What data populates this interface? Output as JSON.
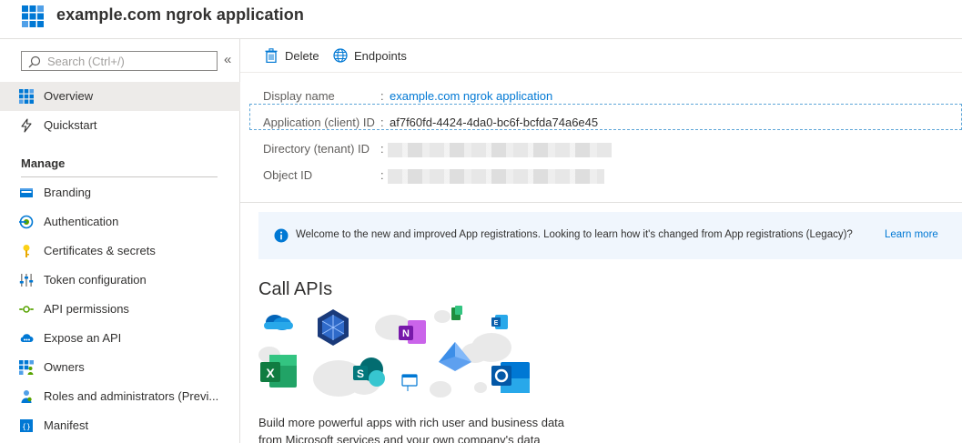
{
  "app": {
    "title": "example.com ngrok application"
  },
  "sidebar": {
    "search_placeholder": "Search (Ctrl+/)",
    "collapse_glyph": "«",
    "top_items": [
      {
        "label": "Overview",
        "icon": "grid-icon",
        "active": true
      },
      {
        "label": "Quickstart",
        "icon": "lightning-icon",
        "active": false
      }
    ],
    "manage_header": "Manage",
    "manage_items": [
      {
        "label": "Branding",
        "icon": "branding-icon"
      },
      {
        "label": "Authentication",
        "icon": "authentication-icon"
      },
      {
        "label": "Certificates & secrets",
        "icon": "key-icon"
      },
      {
        "label": "Token configuration",
        "icon": "token-config-icon"
      },
      {
        "label": "API permissions",
        "icon": "api-permissions-icon"
      },
      {
        "label": "Expose an API",
        "icon": "cloud-api-icon"
      },
      {
        "label": "Owners",
        "icon": "owners-icon"
      },
      {
        "label": "Roles and administrators (Previ...",
        "icon": "roles-icon"
      },
      {
        "label": "Manifest",
        "icon": "manifest-icon"
      }
    ]
  },
  "toolbar": {
    "delete_label": "Delete",
    "endpoints_label": "Endpoints"
  },
  "essentials": {
    "separator": ":",
    "rows": [
      {
        "label": "Display name",
        "value": "example.com ngrok application",
        "is_link": true
      },
      {
        "label": "Application (client) ID",
        "value": "af7f60fd-4424-4da0-bc6f-bcfda74a6e45",
        "is_link": false
      },
      {
        "label": "Directory (tenant) ID",
        "value": "",
        "is_link": false
      },
      {
        "label": "Object ID",
        "value": "",
        "is_link": false
      }
    ]
  },
  "banner": {
    "text": "Welcome to the new and improved App registrations. Looking to learn how it's changed from App registrations (Legacy)?",
    "link": "Learn more"
  },
  "call_apis": {
    "title": "Call APIs",
    "description": "Build more powerful apps with rich user and business data from Microsoft services and your own company's data"
  },
  "colors": {
    "accent": "#0078d4",
    "active_nav": "#edebe9",
    "banner_bg": "#f0f6fd"
  }
}
